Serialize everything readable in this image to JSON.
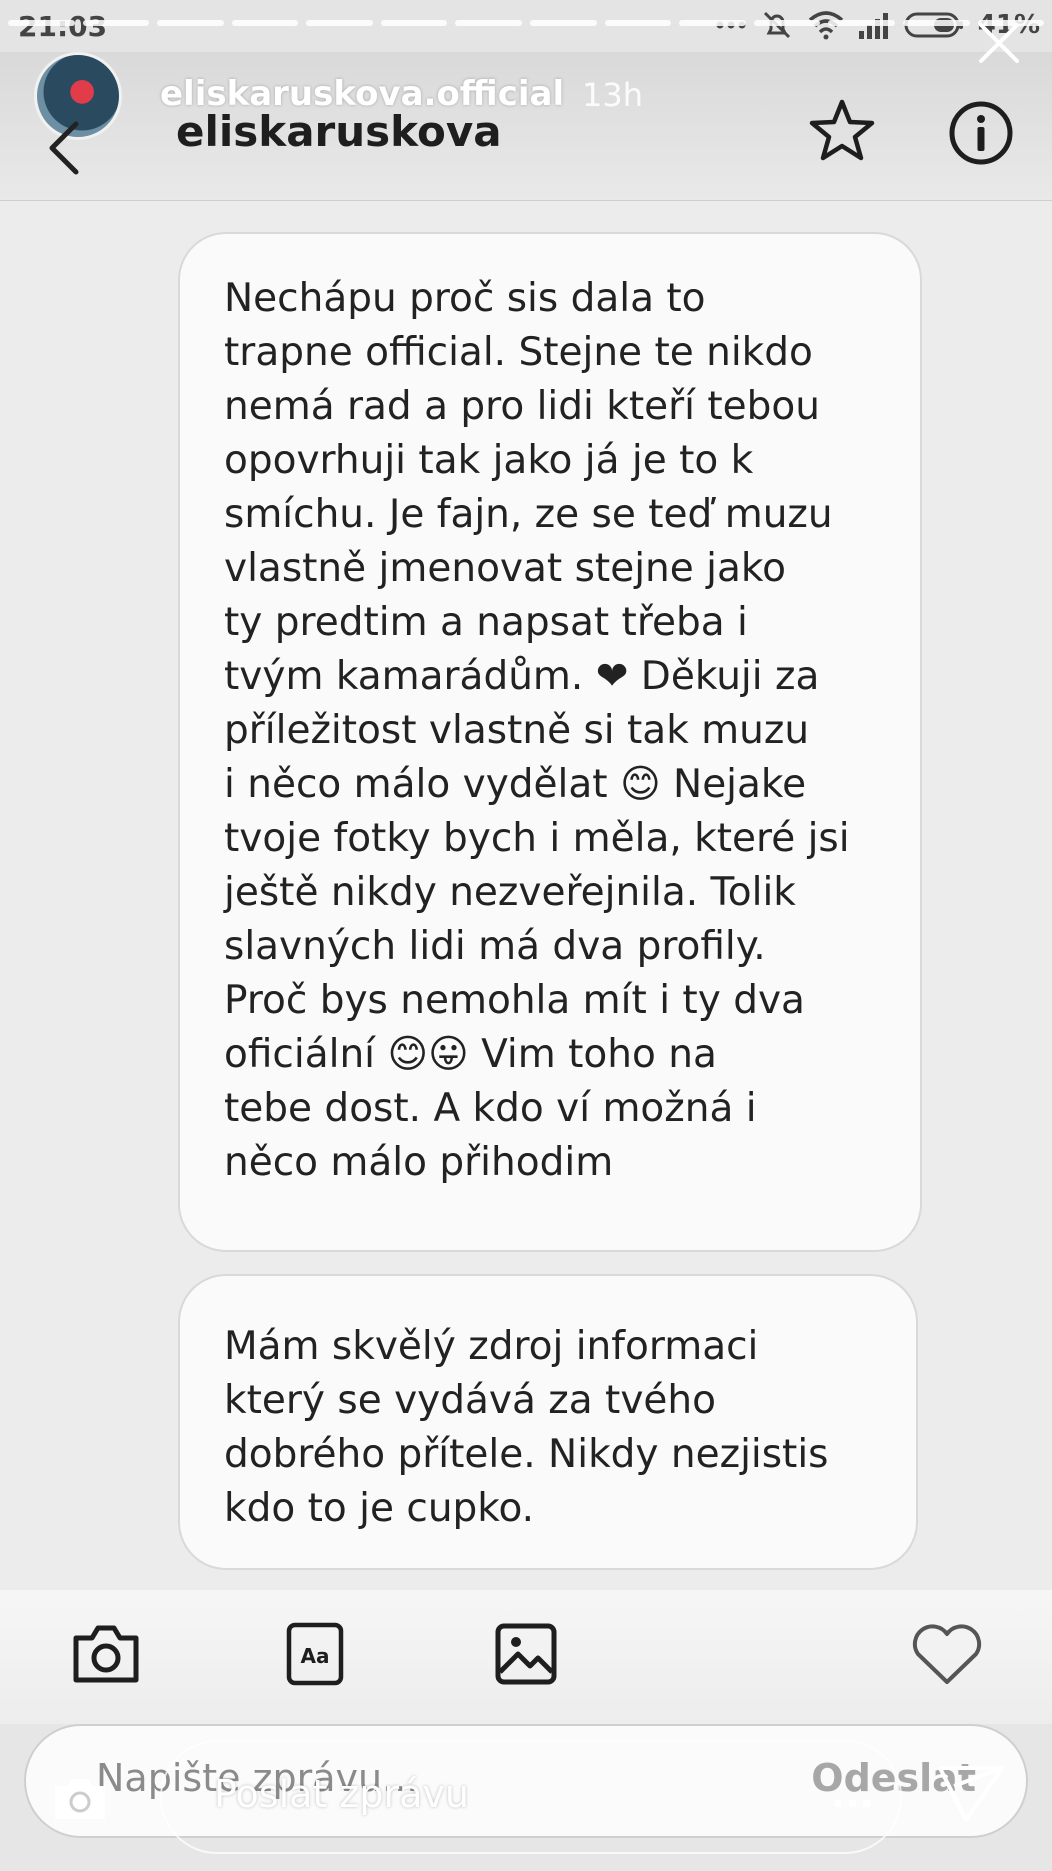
{
  "status_bar": {
    "time": "21:03",
    "battery": "41%"
  },
  "story_overlay": {
    "username": "eliskaruskova.official",
    "time_ago": "13h",
    "reply_placeholder": "Poslat zprávu",
    "more": "..."
  },
  "header": {
    "title": "eliskaruskova"
  },
  "messages": [
    {
      "text": "Nechápu proč sis dala to\ntrapne official. Stejne te nikdo\nnemá rad a pro lidi kteří tebou\nopovrhuji tak jako já je to k\nsmíchu. Je fajn, ze se teď muzu\nvlastně jmenovat stejne jako\nty predtim a napsat třeba i\ntvým kamarádům. ❤ Děkuji za\npříležitost vlastně si tak muzu\ni něco málo vydělat 😊 Nejake\ntvoje fotky bych i měla, které jsi\nještě nikdy nezveřejnila. Tolik\nslavných lidi má dva profily.\nProč bys nemohla mít i ty dva\noficiální 😊😛 Vim toho na\ntebe dost. A kdo ví možná i\nněco málo přihodim"
    },
    {
      "text": "Mám skvělý zdroj informaci\nkterý se vydává za tvého\ndobrého přítele. Nikdy nezjistis\nkdo to je cupko."
    }
  ],
  "composer": {
    "placeholder": "Napište zprávu...",
    "send_label": "Odeslat"
  },
  "icons": {
    "back": "chevron-left-icon",
    "star": "star-icon",
    "info": "info-icon",
    "close": "close-icon",
    "camera": "camera-icon",
    "text": "text-format-icon",
    "gallery": "image-icon",
    "like": "heart-icon",
    "send": "paper-plane-icon"
  }
}
